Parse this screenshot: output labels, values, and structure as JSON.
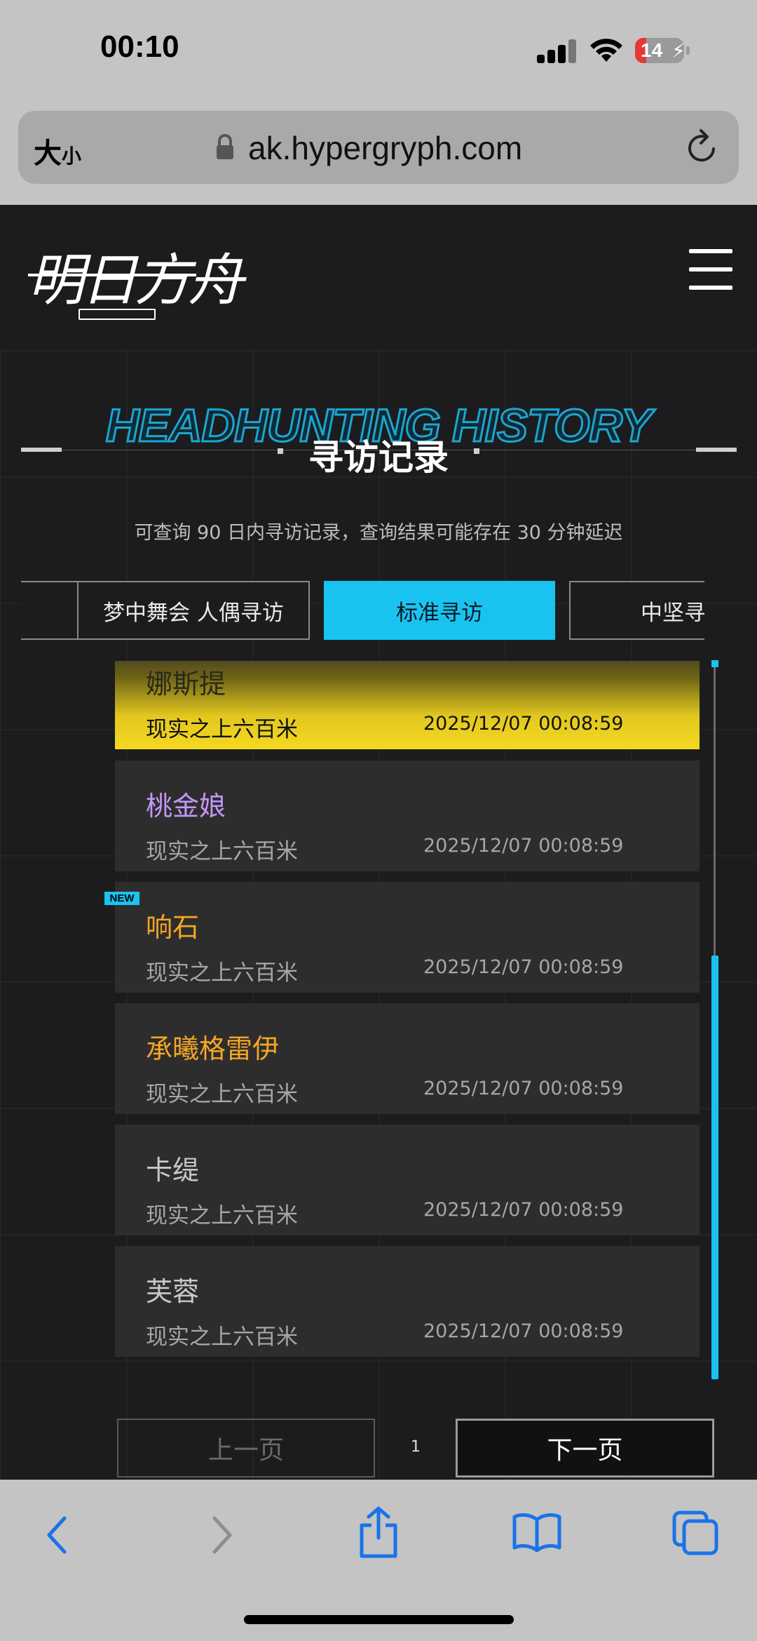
{
  "status_bar": {
    "time": "00:10",
    "battery": "14"
  },
  "browser": {
    "text_size_label_big": "大",
    "text_size_label_small": "小",
    "url": "ak.hypergryph.com"
  },
  "site": {
    "logo_text": "明日方舟"
  },
  "section": {
    "title_en": "HEADHUNTING HISTORY",
    "title_zh": "寻访记录",
    "subtitle": "可查询 90 日内寻访记录，查询结果可能存在 30 分钟延迟"
  },
  "tabs": [
    {
      "label": ""
    },
    {
      "label": "梦中舞会 人偶寻访"
    },
    {
      "label": "标准寻访"
    },
    {
      "label": "中坚寻访"
    }
  ],
  "records": [
    {
      "name": "娜斯提",
      "pool": "现实之上六百米",
      "time": "2025/12/07 00:08:59",
      "rarity": 6
    },
    {
      "name": "桃金娘",
      "pool": "现实之上六百米",
      "time": "2025/12/07 00:08:59",
      "rarity": 4
    },
    {
      "name": "响石",
      "pool": "现实之上六百米",
      "time": "2025/12/07 00:08:59",
      "rarity": 5,
      "badge": "NEW"
    },
    {
      "name": "承曦格雷伊",
      "pool": "现实之上六百米",
      "time": "2025/12/07 00:08:59",
      "rarity": 5
    },
    {
      "name": "卡缇",
      "pool": "现实之上六百米",
      "time": "2025/12/07 00:08:59",
      "rarity": 3
    },
    {
      "name": "芙蓉",
      "pool": "现实之上六百米",
      "time": "2025/12/07 00:08:59",
      "rarity": 3
    }
  ],
  "pagination": {
    "prev_label": "上一页",
    "page": "1",
    "next_label": "下一页"
  },
  "colors": {
    "accent": "#19c3f0",
    "rarity6": "#3a3a1a",
    "rarity5": "#f5a623",
    "rarity4": "#c596f5",
    "rarity3": "#c8c8c8"
  }
}
